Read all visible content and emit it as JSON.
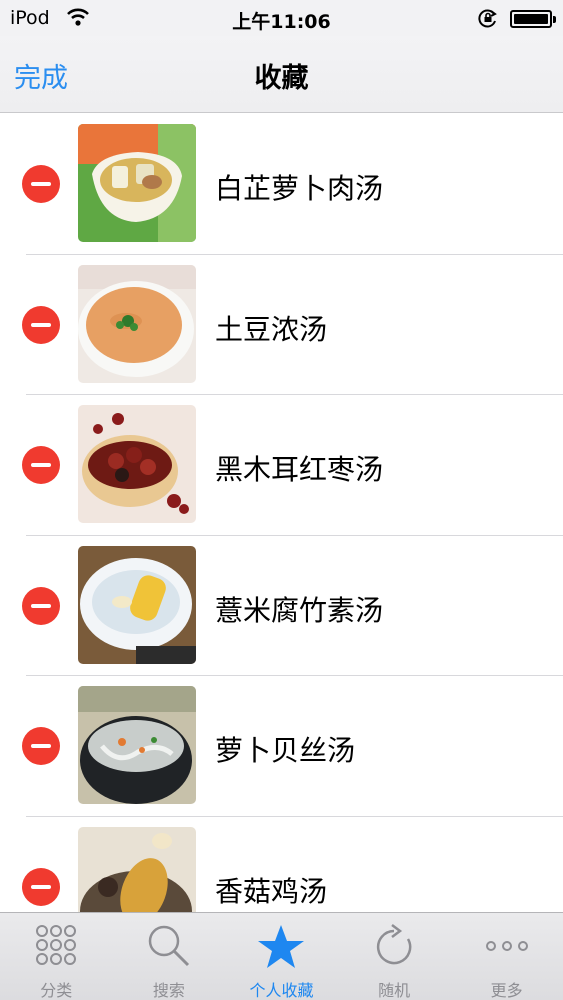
{
  "status_bar": {
    "carrier": "iPod",
    "time": "上午11:06"
  },
  "nav": {
    "done_label": "完成",
    "title": "收藏"
  },
  "favorites": [
    {
      "label": "白芷萝卜肉汤"
    },
    {
      "label": "土豆浓汤"
    },
    {
      "label": "黑木耳红枣汤"
    },
    {
      "label": "薏米腐竹素汤"
    },
    {
      "label": "萝卜贝丝汤"
    },
    {
      "label": "香菇鸡汤"
    }
  ],
  "tabs": [
    {
      "label": "分类",
      "icon": "grid-icon",
      "active": false
    },
    {
      "label": "搜索",
      "icon": "search-icon",
      "active": false
    },
    {
      "label": "个人收藏",
      "icon": "star-icon",
      "active": true
    },
    {
      "label": "随机",
      "icon": "refresh-icon",
      "active": false
    },
    {
      "label": "更多",
      "icon": "more-icon",
      "active": false
    }
  ],
  "colors": {
    "accent": "#1e87f0",
    "delete": "#f03a2f",
    "inactive": "#8e8e93"
  }
}
